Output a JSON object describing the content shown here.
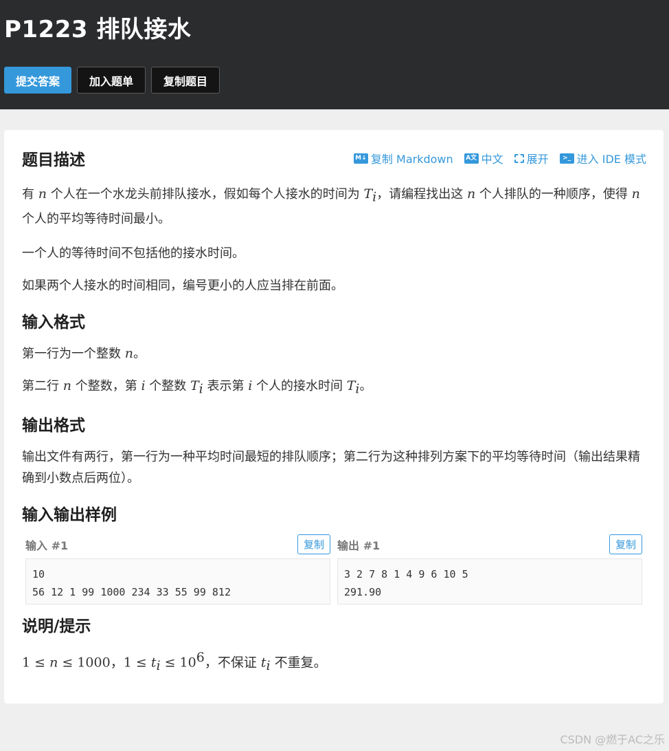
{
  "header": {
    "title": "P1223 排队接水",
    "buttons": {
      "submit": "提交答案",
      "add_list": "加入题单",
      "copy_problem": "复制题目"
    }
  },
  "toolbar": {
    "copy_markdown": "复制 Markdown",
    "chinese": "中文",
    "expand": "展开",
    "ide_mode": "进入 IDE 模式",
    "md_icon": "M↓",
    "lang_icon": "A文",
    "ide_icon": ">_"
  },
  "description": {
    "heading": "题目描述",
    "p1_a": "有 ",
    "p1_n1": "n",
    "p1_b": " 个人在一个水龙头前排队接水，假如每个人接水的时间为 ",
    "p1_T": "T",
    "p1_i": "i",
    "p1_c": "，请编程找出这 ",
    "p1_n2": "n",
    "p1_d": " 个人排队的一种顺序，使得 ",
    "p1_n3": "n",
    "p1_e": " 个人的平均等待时间最小。",
    "p2": "一个人的等待时间不包括他的接水时间。",
    "p3": "如果两个人接水的时间相同，编号更小的人应当排在前面。"
  },
  "input_format": {
    "heading": "输入格式",
    "l1_a": "第一行为一个整数 ",
    "l1_n": "n",
    "l1_b": "。",
    "l2_a": "第二行 ",
    "l2_n": "n",
    "l2_b": " 个整数，第 ",
    "l2_i": "i",
    "l2_c": " 个整数 ",
    "l2_T": "T",
    "l2_Ti": "i",
    "l2_d": " 表示第 ",
    "l2_i2": "i",
    "l2_e": " 个人的接水时间 ",
    "l2_T2": "T",
    "l2_Ti2": "i",
    "l2_f": "。"
  },
  "output_format": {
    "heading": "输出格式",
    "text": "输出文件有两行，第一行为一种平均时间最短的排队顺序；第二行为这种排列方案下的平均等待时间（输出结果精确到小数点后两位）。"
  },
  "samples": {
    "heading": "输入输出样例",
    "input_label": "输入 #1",
    "output_label": "输出 #1",
    "copy": "复制",
    "input_text": "10\n56 12 1 99 1000 234 33 55 99 812",
    "output_text": "3 2 7 8 1 4 9 6 10 5\n291.90"
  },
  "hint": {
    "heading": "说明/提示",
    "m1": "1 ≤ ",
    "m1_n": "n",
    "m1_b": " ≤ 1000",
    "sep": "，",
    "m2": "1 ≤ ",
    "m2_t": "t",
    "m2_i": "i",
    "m2_b": " ≤ 10",
    "m2_exp": "6",
    "text_a": "，不保证 ",
    "t3": "t",
    "t3_i": "i",
    "text_b": " 不重复。"
  },
  "watermark": "CSDN @燃于AC之乐"
}
